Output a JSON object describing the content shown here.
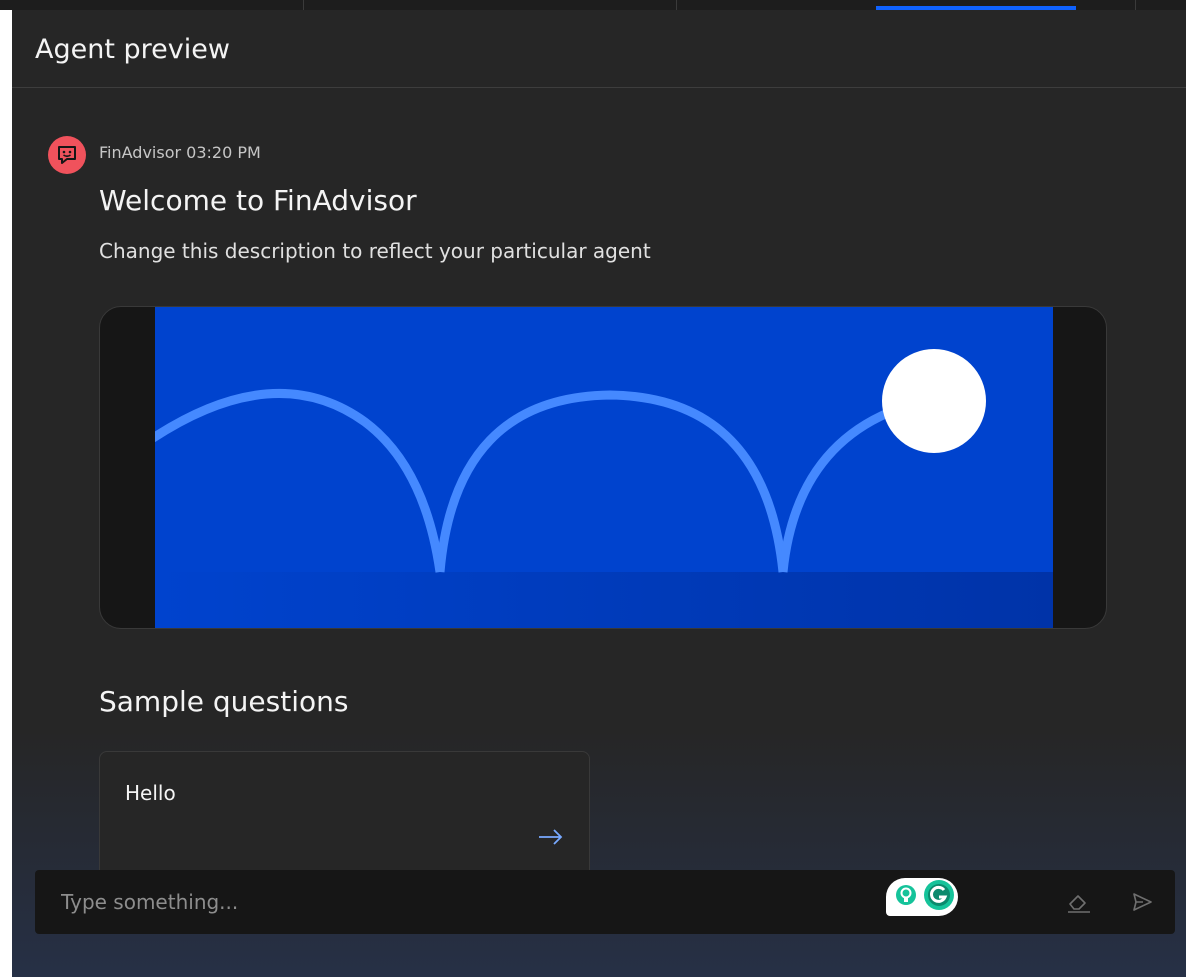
{
  "header": {
    "title": "Agent preview"
  },
  "message": {
    "avatar_icon": "chat-bot-icon",
    "meta": "FinAdvisor 03:20 PM",
    "title": "Welcome to FinAdvisor",
    "description": "Change this description to reflect your particular agent"
  },
  "banner": {
    "colors": {
      "sky": "#0043ce",
      "ground": "#0039b3",
      "arc": "#4589ff",
      "ball": "#ffffff"
    }
  },
  "sample_questions": {
    "heading": "Sample questions",
    "items": [
      {
        "label": "Hello",
        "icon": "arrow-right-icon"
      }
    ]
  },
  "composer": {
    "placeholder": "Type something...",
    "clear_icon": "eraser-icon",
    "send_icon": "send-icon",
    "extension_icons": [
      "idea-bulb-icon",
      "grammarly-icon"
    ]
  },
  "colors": {
    "panel_bg": "#262626",
    "avatar": "#f0525c",
    "accent": "#0f62fe",
    "grammarly": "#15c39a"
  }
}
